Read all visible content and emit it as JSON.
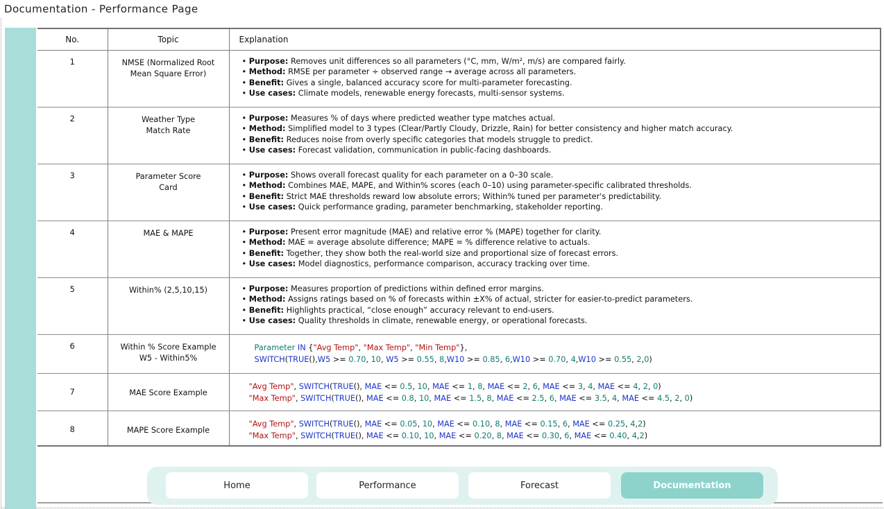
{
  "page": {
    "title": "Documentation - Performance Page"
  },
  "table": {
    "headers": {
      "no": "No.",
      "topic": "Topic",
      "explanation": "Explanation"
    },
    "rows": [
      {
        "no": "1",
        "topic_lines": [
          "NMSE (Normalized Root",
          "Mean Square Error)"
        ],
        "items": [
          {
            "label": "Purpose:",
            "text": " Removes unit differences so all parameters (°C, mm, W/m², m/s) are compared fairly."
          },
          {
            "label": "Method:",
            "text": " RMSE per parameter ÷ observed range → average across all parameters."
          },
          {
            "label": "Benefit:",
            "text": " Gives a single, balanced accuracy score for multi-parameter forecasting."
          },
          {
            "label": "Use cases:",
            "text": " Climate models, renewable energy forecasts, multi-sensor systems."
          }
        ]
      },
      {
        "no": "2",
        "topic_lines": [
          "Weather Type",
          "Match Rate"
        ],
        "items": [
          {
            "label": "Purpose:",
            "text": " Measures % of days where predicted weather type matches actual."
          },
          {
            "label": "Method:",
            "text": " Simplified model to 3 types (Clear/Partly Cloudy, Drizzle, Rain) for better consistency and higher match accuracy."
          },
          {
            "label": "Benefit:",
            "text": " Reduces noise from overly specific categories that models struggle to predict."
          },
          {
            "label": "Use cases:",
            "text": " Forecast validation, communication in public-facing dashboards."
          }
        ]
      },
      {
        "no": "3",
        "topic_lines": [
          "Parameter Score",
          "Card"
        ],
        "items": [
          {
            "label": "Purpose:",
            "text": " Shows overall forecast quality for each parameter on a 0–30 scale."
          },
          {
            "label": "Method:",
            "text": " Combines MAE, MAPE, and Within% scores (each 0–10) using parameter-specific calibrated thresholds."
          },
          {
            "label": "Benefit:",
            "text": " Strict MAE thresholds reward low absolute errors; Within% tuned per parameter's predictability."
          },
          {
            "label": "Use cases:",
            "text": " Quick performance grading, parameter benchmarking, stakeholder reporting."
          }
        ]
      },
      {
        "no": "4",
        "topic_lines": [
          "MAE & MAPE"
        ],
        "items": [
          {
            "label": "Purpose:",
            "text": " Present error magnitude (MAE) and relative error % (MAPE) together for clarity."
          },
          {
            "label": "Method:",
            "text": " MAE = average absolute difference; MAPE = % difference relative to actuals."
          },
          {
            "label": "Benefit:",
            "text": " Together, they show both the real-world size and proportional size of forecast errors."
          },
          {
            "label": "Use cases:",
            "text": " Model diagnostics, performance comparison, accuracy tracking over time."
          }
        ]
      },
      {
        "no": "5",
        "topic_lines": [
          "Within% (2,5,10,15)"
        ],
        "items": [
          {
            "label": "Purpose:",
            "text": " Measures proportion of predictions within defined error margins."
          },
          {
            "label": "Method:",
            "text": " Assigns ratings based on % of forecasts within ±X% of actual, stricter for easier-to-predict parameters."
          },
          {
            "label": "Benefit:",
            "text": " Highlights practical, “close enough” accuracy relevant to end-users."
          },
          {
            "label": "Use cases:",
            "text": " Quality thresholds in climate, renewable energy, or operational forecasts."
          }
        ]
      },
      {
        "no": "6",
        "topic_lines": [
          "Within % Score Example",
          "W5 - Within5%"
        ],
        "code_lines": [
          "Parameter IN {\"Avg Temp\", \"Max Temp\", \"Min Temp\"},",
          "SWITCH(TRUE(),W5 >= 0.70, 10, W5 >= 0.55, 8,W10 >= 0.85, 6,W10 >= 0.70, 4,W10 >= 0.55, 2,0)"
        ]
      },
      {
        "no": "7",
        "topic_lines": [
          "MAE Score Example"
        ],
        "code_lines": [
          "\"Avg Temp\", SWITCH(TRUE(), MAE <= 0.5, 10, MAE <= 1, 8, MAE <= 2, 6, MAE <= 3, 4, MAE <= 4, 2, 0)",
          "\"Max Temp\", SWITCH(TRUE(), MAE <= 0.8, 10, MAE <= 1.5, 8, MAE <= 2.5, 6, MAE <= 3.5, 4, MAE <= 4.5, 2, 0)"
        ]
      },
      {
        "no": "8",
        "topic_lines": [
          "MAPE Score Example"
        ],
        "code_lines": [
          "\"Avg Temp\", SWITCH(TRUE(), MAE <= 0.05, 10, MAE <= 0.10, 8, MAE <= 0.15, 6, MAE <= 0.25, 4,2)",
          "\"Max Temp\", SWITCH(TRUE(), MAE <= 0.10, 10, MAE <= 0.20, 8, MAE <= 0.30, 6, MAE <= 0.40, 4,2)"
        ]
      }
    ]
  },
  "nav": {
    "buttons": [
      {
        "label": "Home",
        "active": false
      },
      {
        "label": "Performance",
        "active": false
      },
      {
        "label": "Forecast",
        "active": false
      },
      {
        "label": "Documentation",
        "active": true
      }
    ]
  },
  "colors": {
    "accent": "#a8ddd9",
    "nav_background": "#dff2f0",
    "nav_active": "#8dd3cc",
    "code_string": "#b01212",
    "code_keyword": "#1a33c8",
    "code_number": "#0f7c6f"
  }
}
